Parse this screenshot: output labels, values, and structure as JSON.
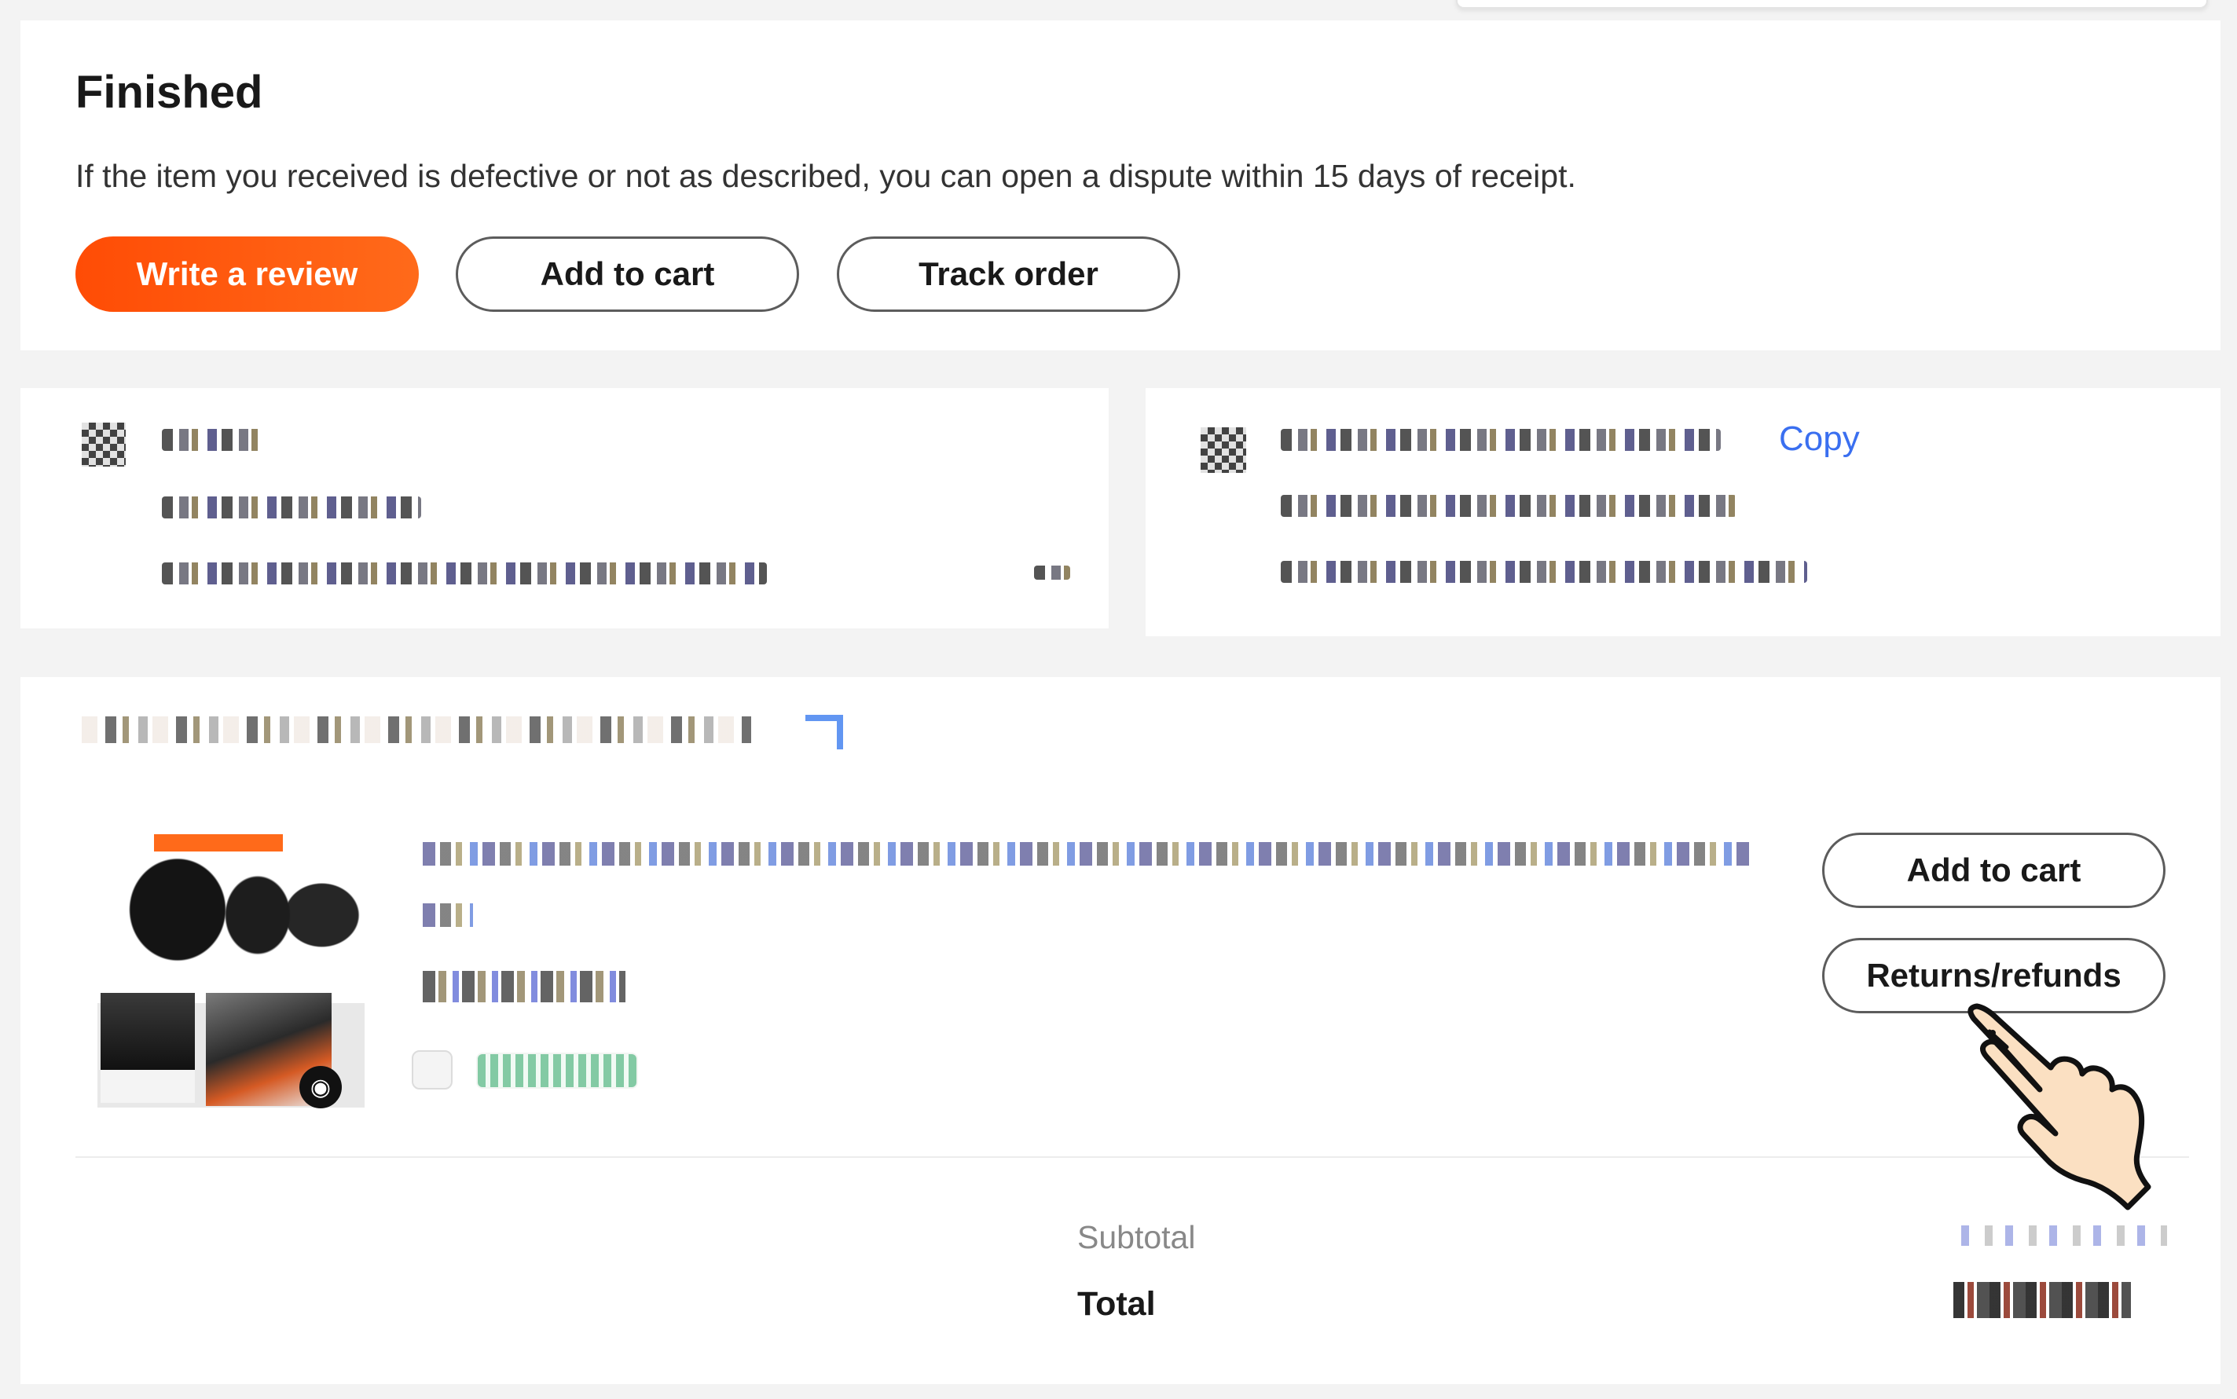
{
  "status": {
    "title": "Finished",
    "description": "If the item you received is defective or not as described, you can open a dispute within 15 days of receipt.",
    "buttons": {
      "write_review": "Write a review",
      "add_to_cart": "Add to cart",
      "track_order": "Track order"
    }
  },
  "address_card": {
    "icon": "location-icon"
  },
  "order_info_card": {
    "icon": "order-icon",
    "copy_label": "Copy"
  },
  "order_item": {
    "store_icon": "store-arrow-icon",
    "image_icon": "camera-icon",
    "buttons": {
      "add_to_cart": "Add to cart",
      "returns_refunds": "Returns/refunds"
    }
  },
  "summary": {
    "subtotal_label": "Subtotal",
    "total_label": "Total"
  },
  "colors": {
    "primary": "#ff4c05",
    "link": "#3a6ff0",
    "background": "#f3f3f3"
  },
  "cursor": "pointing-hand-cursor-icon"
}
